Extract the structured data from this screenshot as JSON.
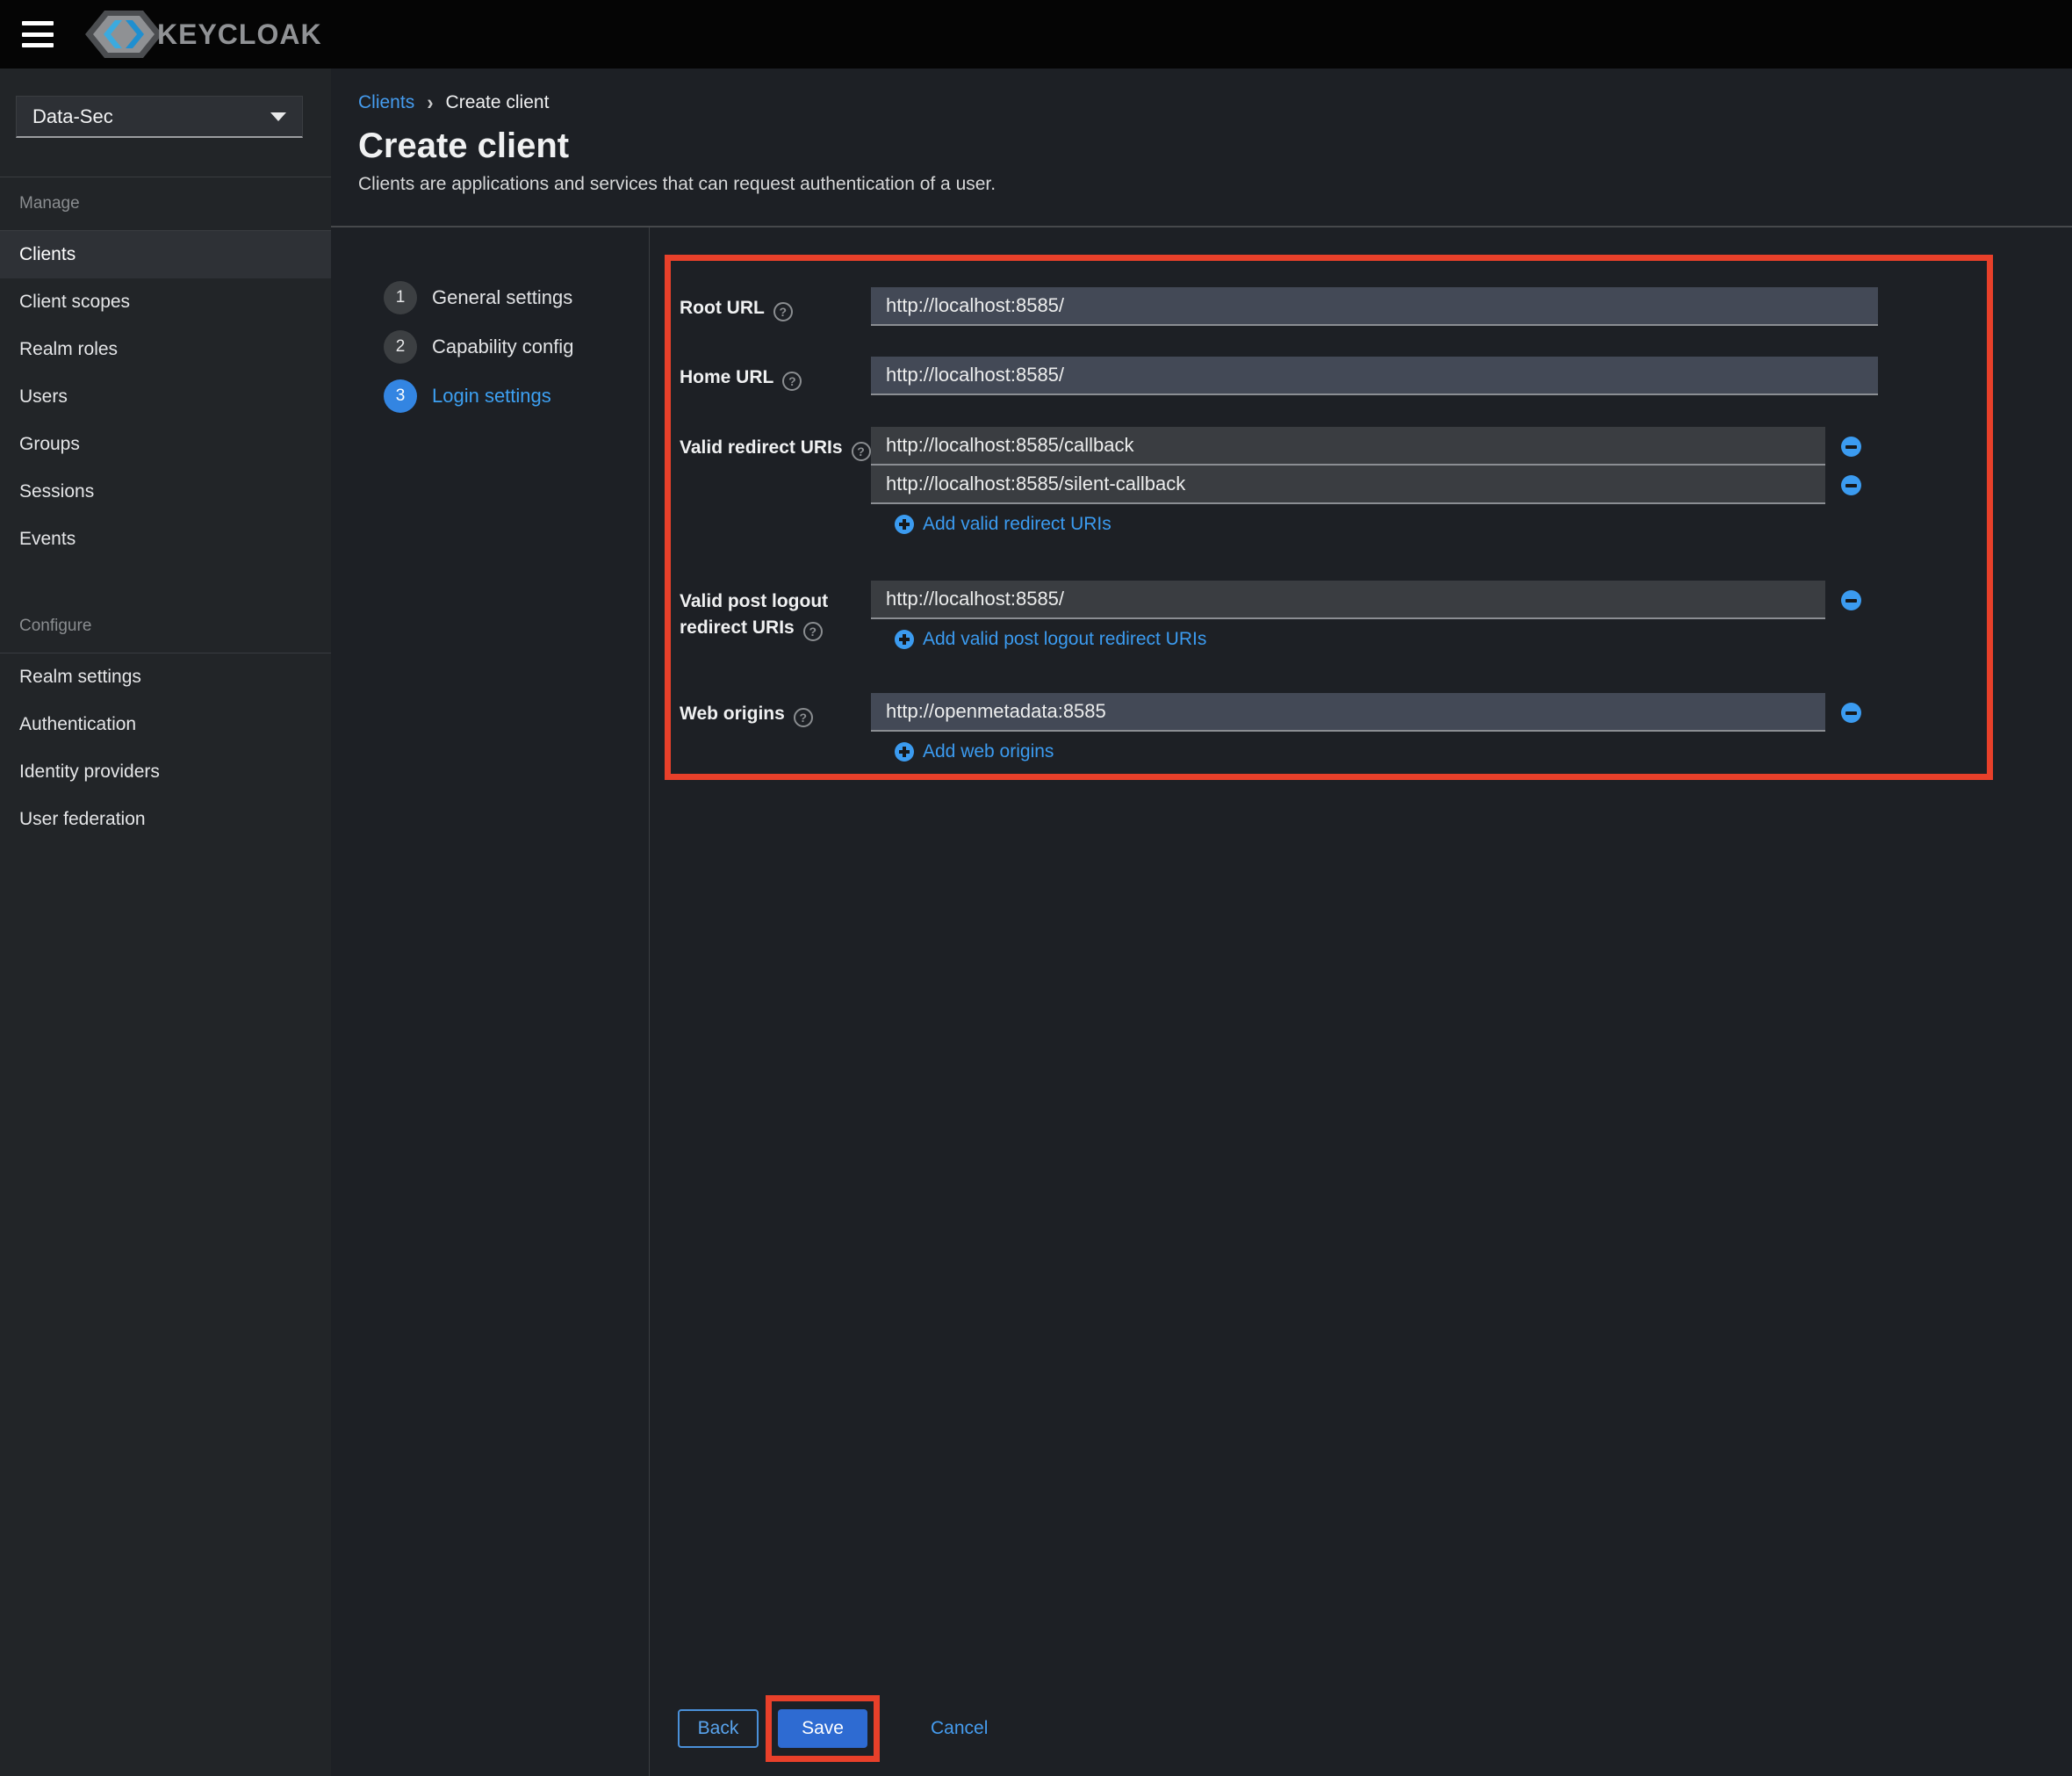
{
  "masthead": {
    "brand": "KEYCLOAK"
  },
  "sidebar": {
    "realm": "Data-Sec",
    "manage": {
      "label": "Manage",
      "items": [
        "Clients",
        "Client scopes",
        "Realm roles",
        "Users",
        "Groups",
        "Sessions",
        "Events"
      ]
    },
    "configure": {
      "label": "Configure",
      "items": [
        "Realm settings",
        "Authentication",
        "Identity providers",
        "User federation"
      ]
    }
  },
  "breadcrumb": {
    "parent": "Clients",
    "current": "Create client"
  },
  "page": {
    "title": "Create client",
    "description": "Clients are applications and services that can request authentication of a user."
  },
  "wizard": {
    "steps": [
      {
        "num": "1",
        "label": "General settings"
      },
      {
        "num": "2",
        "label": "Capability config"
      },
      {
        "num": "3",
        "label": "Login settings"
      }
    ]
  },
  "form": {
    "fields": [
      {
        "label": "Root URL",
        "values": [
          "http://localhost:8585/"
        ]
      },
      {
        "label": "Home URL",
        "values": [
          "http://localhost:8585/"
        ]
      },
      {
        "label": "Valid redirect URIs",
        "values": [
          "http://localhost:8585/callback",
          "http://localhost:8585/silent-callback"
        ],
        "add_label": "Add valid redirect URIs"
      },
      {
        "label": "Valid post logout redirect URIs",
        "values": [
          "http://localhost:8585/"
        ],
        "add_label": "Add valid post logout redirect URIs"
      },
      {
        "label": "Web origins",
        "values": [
          "http://openmetadata:8585"
        ],
        "add_label": "Add web origins"
      }
    ]
  },
  "actions": {
    "back": "Back",
    "save": "Save",
    "cancel": "Cancel"
  },
  "colors": {
    "annotation_red": "#e8402a",
    "primary_blue": "#2e6bd2",
    "link_blue": "#459cef",
    "active_step_blue": "#3385e2",
    "input_blue_bg": "#434956",
    "input_dark_bg": "#3a3d41"
  }
}
